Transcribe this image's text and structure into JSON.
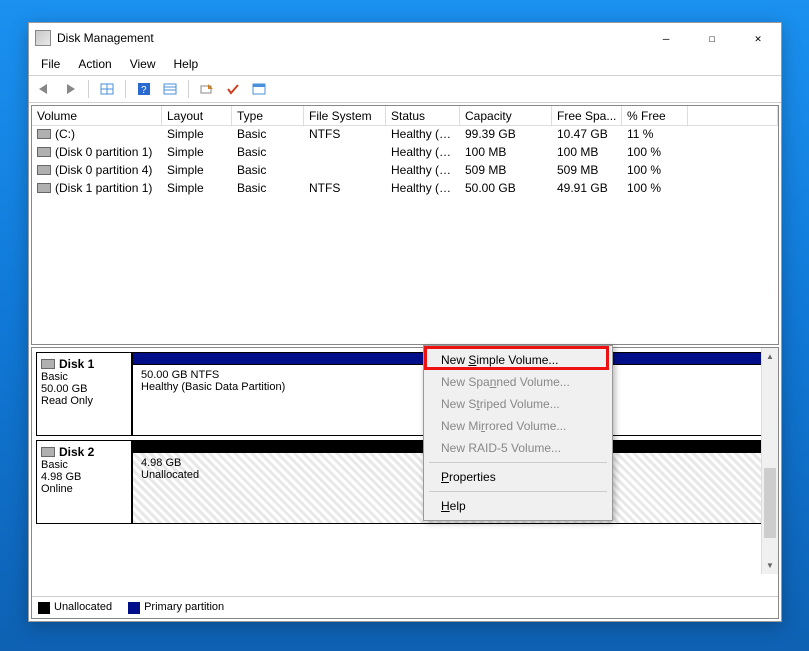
{
  "window": {
    "title": "Disk Management",
    "min_glyph": "—",
    "max_glyph": "☐",
    "close_glyph": "✕"
  },
  "menu": {
    "file": "File",
    "action": "Action",
    "view": "View",
    "help": "Help"
  },
  "columns": [
    "Volume",
    "Layout",
    "Type",
    "File System",
    "Status",
    "Capacity",
    "Free Spa...",
    "% Free",
    ""
  ],
  "volumes": [
    {
      "name": "(C:)",
      "layout": "Simple",
      "type": "Basic",
      "fs": "NTFS",
      "status": "Healthy (B...",
      "cap": "99.39 GB",
      "free": "10.47 GB",
      "pct": "11 %"
    },
    {
      "name": "(Disk 0 partition 1)",
      "layout": "Simple",
      "type": "Basic",
      "fs": "",
      "status": "Healthy (R...",
      "cap": "100 MB",
      "free": "100 MB",
      "pct": "100 %"
    },
    {
      "name": "(Disk 0 partition 4)",
      "layout": "Simple",
      "type": "Basic",
      "fs": "",
      "status": "Healthy (R...",
      "cap": "509 MB",
      "free": "509 MB",
      "pct": "100 %"
    },
    {
      "name": "(Disk 1 partition 1)",
      "layout": "Simple",
      "type": "Basic",
      "fs": "NTFS",
      "status": "Healthy (B...",
      "cap": "50.00 GB",
      "free": "49.91 GB",
      "pct": "100 %"
    }
  ],
  "disks": {
    "d1": {
      "title": "Disk 1",
      "type": "Basic",
      "size": "50.00 GB",
      "state": "Read Only",
      "part_line1": "50.00 GB NTFS",
      "part_line2": "Healthy (Basic Data Partition)"
    },
    "d2": {
      "title": "Disk 2",
      "type": "Basic",
      "size": "4.98 GB",
      "state": "Online",
      "part_line1": "4.98 GB",
      "part_line2": "Unallocated"
    }
  },
  "legend": {
    "unalloc": "Unallocated",
    "primary": "Primary partition"
  },
  "context": {
    "new_simple": "New Simple Volume...",
    "new_spanned": "New Spanned Volume...",
    "new_striped": "New Striped Volume...",
    "new_mirrored": "New Mirrored Volume...",
    "new_raid5": "New RAID-5 Volume...",
    "properties": "Properties",
    "help": "Help"
  }
}
